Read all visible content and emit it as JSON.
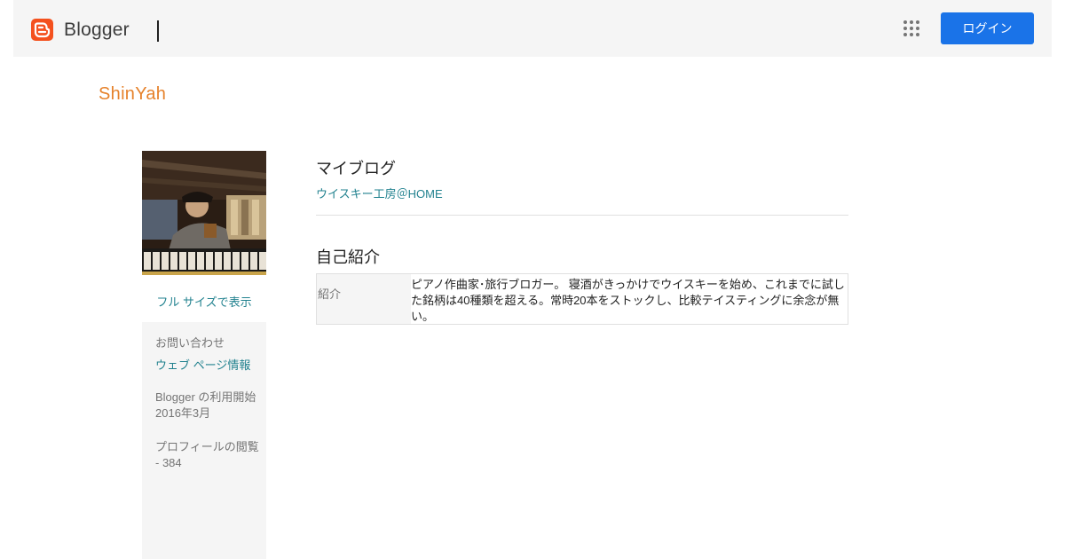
{
  "header": {
    "brand": "Blogger",
    "login_label": "ログイン"
  },
  "blog": {
    "title": "ShinYah"
  },
  "profile": {
    "fullsize_label": "フル サイズで表示",
    "sidebar": {
      "contact_label": "お問い合わせ",
      "webpage_link": "ウェブ ページ情報",
      "since_label": "Blogger の利用開始",
      "since_value": "2016年3月",
      "views_label": "プロフィールの閲覧 - 384"
    }
  },
  "main": {
    "myblog_heading": "マイブログ",
    "blog_link": "ウイスキー工房＠HOME",
    "about_heading": "自己紹介",
    "about_key": "紹介",
    "about_value": "ピアノ作曲家･旅行ブロガー。 寝酒がきっかけでウイスキーを始め、これまでに試した銘柄は40種類を超える。常時20本をストックし、比較テイスティングに余念が無い。"
  },
  "colors": {
    "brand_orange": "#f4511e",
    "title_orange": "#e6822b",
    "link_teal": "#22828f",
    "button_blue": "#1a73e8"
  },
  "icons": {
    "logo": "blogger-logo-icon",
    "apps": "apps-grid-icon"
  }
}
